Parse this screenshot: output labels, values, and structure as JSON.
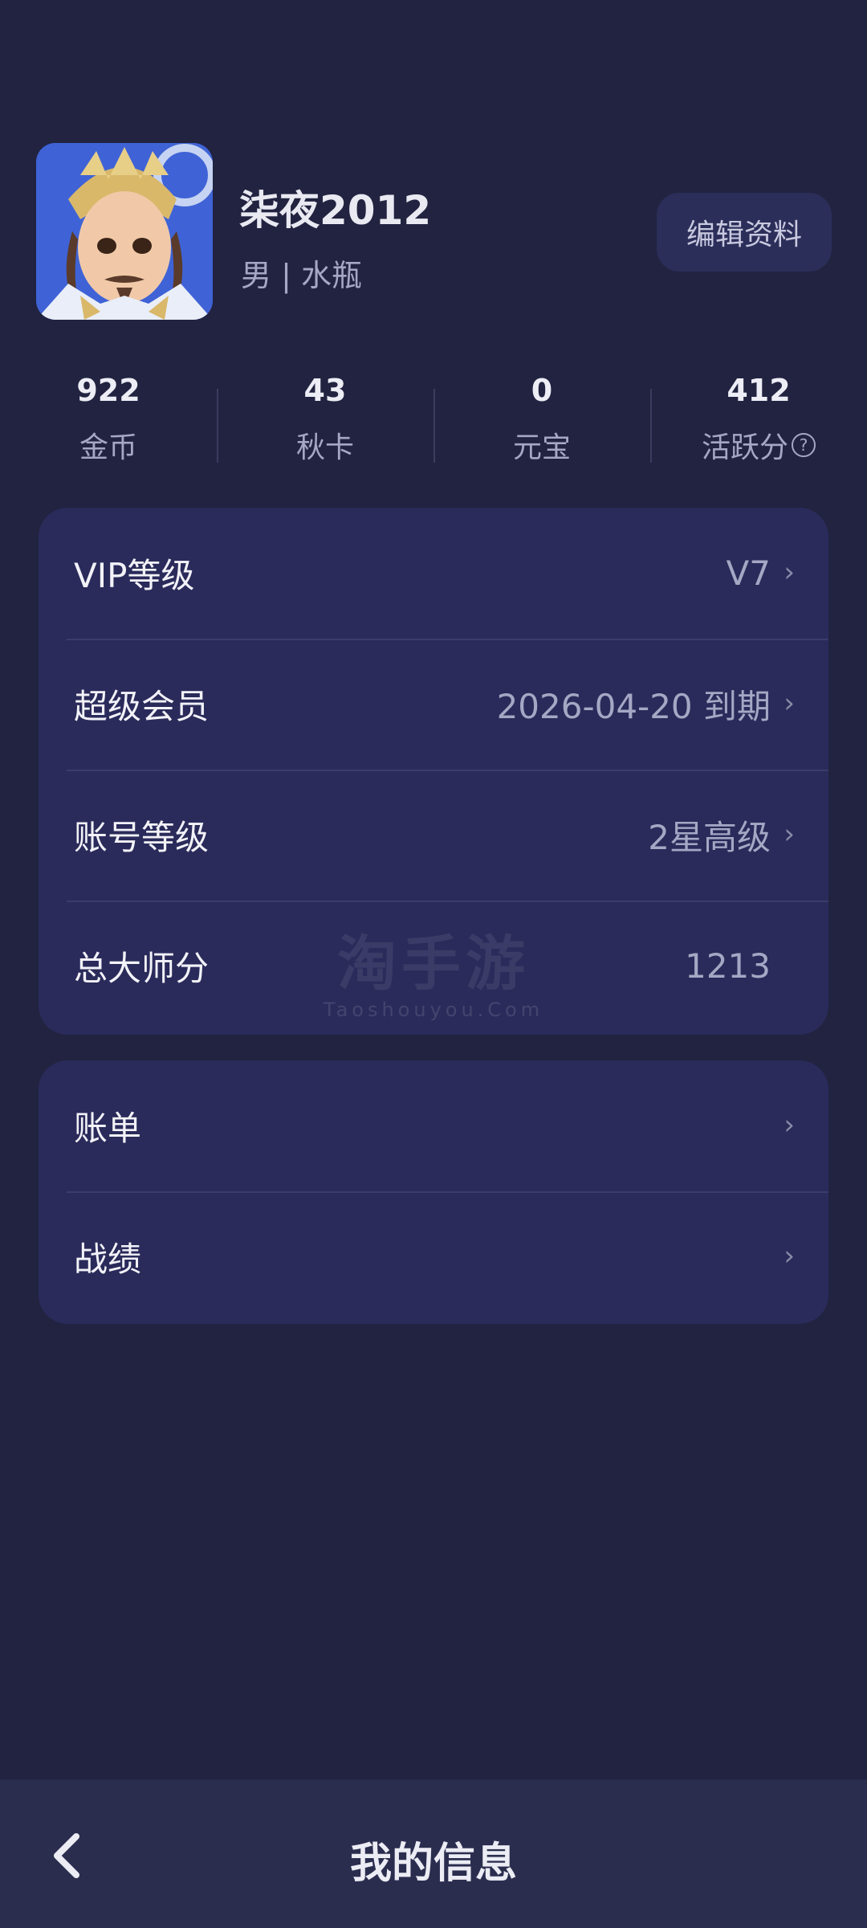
{
  "profile": {
    "name": "柒夜2012",
    "subinfo": "男 | 水瓶",
    "edit_label": "编辑资料"
  },
  "stats": [
    {
      "value": "922",
      "label": "金币"
    },
    {
      "value": "43",
      "label": "秋卡"
    },
    {
      "value": "0",
      "label": "元宝"
    },
    {
      "value": "412",
      "label": "活跃分",
      "help": "?"
    }
  ],
  "card1": {
    "rows": [
      {
        "label": "VIP等级",
        "value": "V7"
      },
      {
        "label": "超级会员",
        "value": "2026-04-20 到期"
      },
      {
        "label": "账号等级",
        "value": "2星高级"
      },
      {
        "label": "总大师分",
        "value": "1213"
      }
    ]
  },
  "card2": {
    "rows": [
      {
        "label": "账单"
      },
      {
        "label": "战绩"
      }
    ]
  },
  "watermark": {
    "cn": "淘手游",
    "en": "Taoshouyou.Com"
  },
  "bottom_bar": {
    "title": "我的信息"
  },
  "colors": {
    "background": "#212340",
    "card": "#2a2b5a",
    "bottom_bar": "#2b2d4f",
    "muted_text": "#a6a7c4"
  },
  "icons": {
    "chevron": "chevron-right-icon",
    "back": "back-arrow-icon",
    "help": "question-circle-icon"
  }
}
